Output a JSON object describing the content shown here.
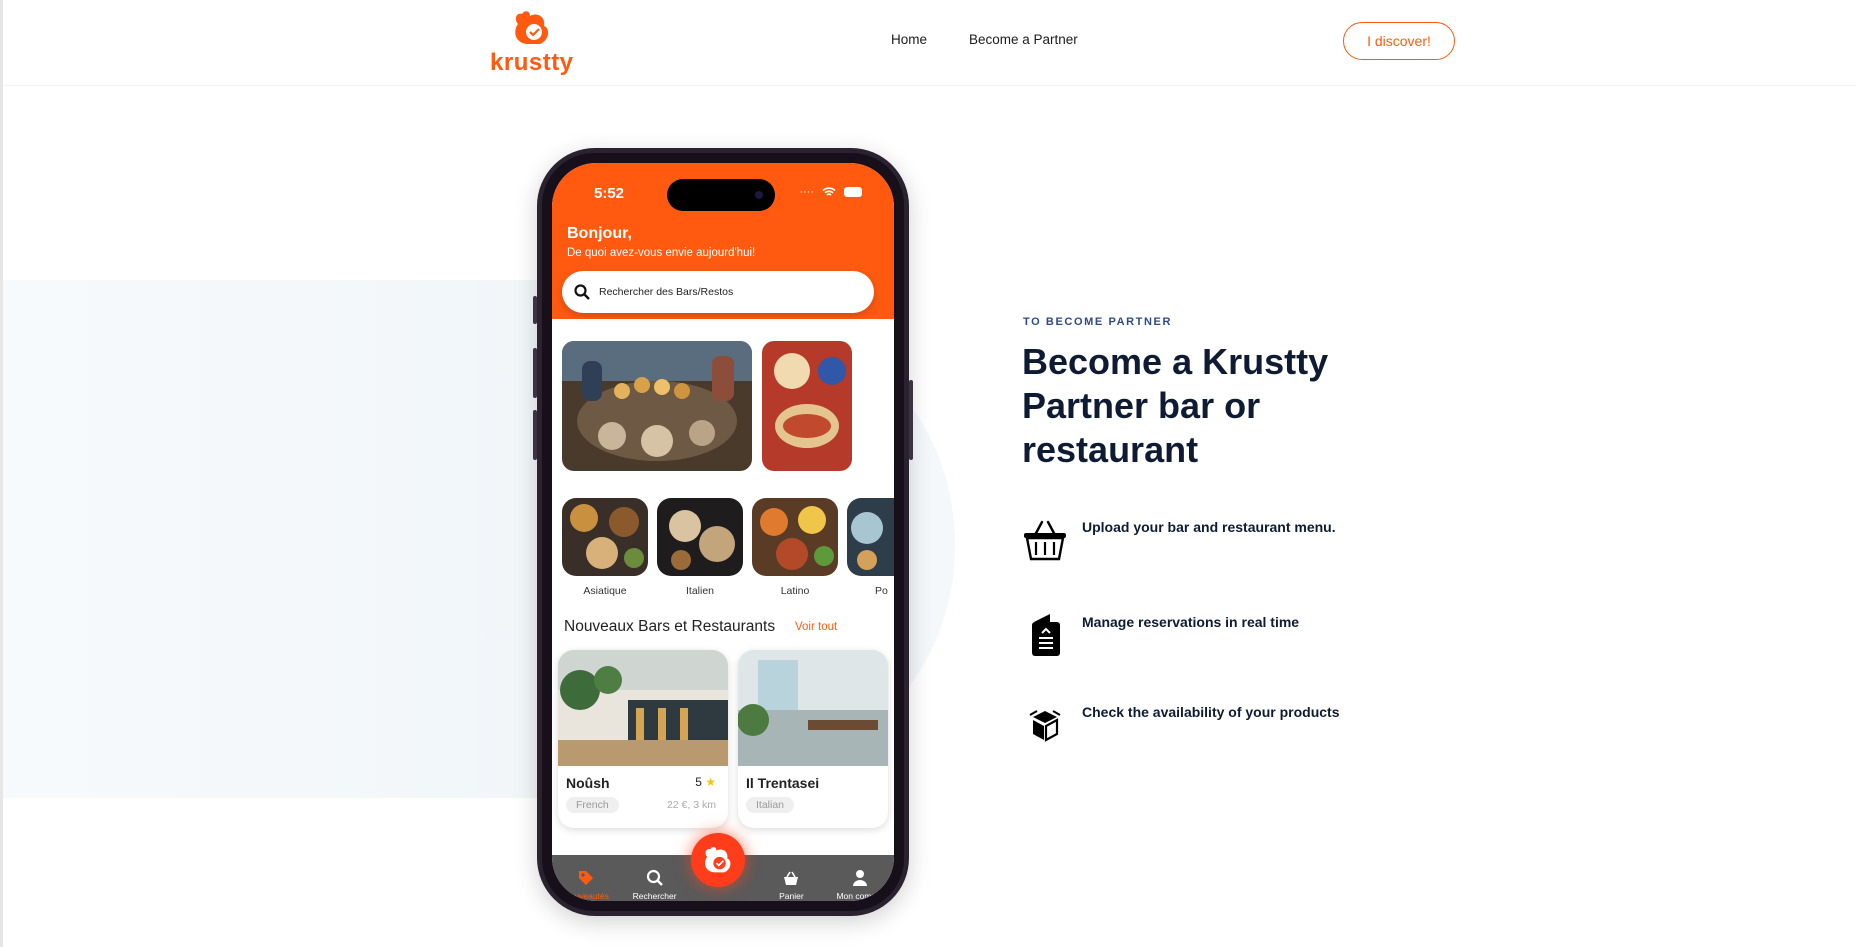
{
  "header": {
    "logo_text": "krustty",
    "nav": [
      {
        "label": "Home"
      },
      {
        "label": "Become a Partner"
      }
    ],
    "cta_label": "I discover!"
  },
  "phone": {
    "status_time": "5:52",
    "greeting": "Bonjour,",
    "greeting_sub": "De quoi avez-vous envie aujourd'hui!",
    "search_placeholder": "Rechercher des Bars/Restos",
    "categories": [
      {
        "label": "Asiatique"
      },
      {
        "label": "Italien"
      },
      {
        "label": "Latino"
      },
      {
        "label": "Po"
      }
    ],
    "section_title": "Nouveaux Bars et Restaurants",
    "see_all": "Voir tout",
    "restaurants": [
      {
        "name": "Noûsh",
        "rating": "5",
        "tag": "French",
        "distance": "22 €, 3 km"
      },
      {
        "name": "Il Trentasei",
        "tag": "Italian"
      }
    ],
    "tabs": [
      {
        "label": "Nouveautés",
        "icon": "tag-icon"
      },
      {
        "label": "Rechercher",
        "icon": "search-icon"
      },
      {
        "label": "",
        "icon": "squirrel-logo-icon"
      },
      {
        "label": "Panier",
        "icon": "basket-icon"
      },
      {
        "label": "Mon compte",
        "icon": "user-icon"
      }
    ]
  },
  "content": {
    "eyebrow": "TO BECOME PARTNER",
    "title": "Become a Krustty Partner bar or restaurant",
    "features": [
      {
        "text": "Upload your bar and restaurant menu.",
        "icon": "shopping-basket-icon"
      },
      {
        "text": "Manage reservations in real time",
        "icon": "reservation-ticket-icon"
      },
      {
        "text": "Check the availability of your products",
        "icon": "product-box-icon"
      }
    ]
  },
  "colors": {
    "brand": "#ff5a10",
    "heading": "#0f1b33",
    "eyebrow": "#2f4a85"
  }
}
